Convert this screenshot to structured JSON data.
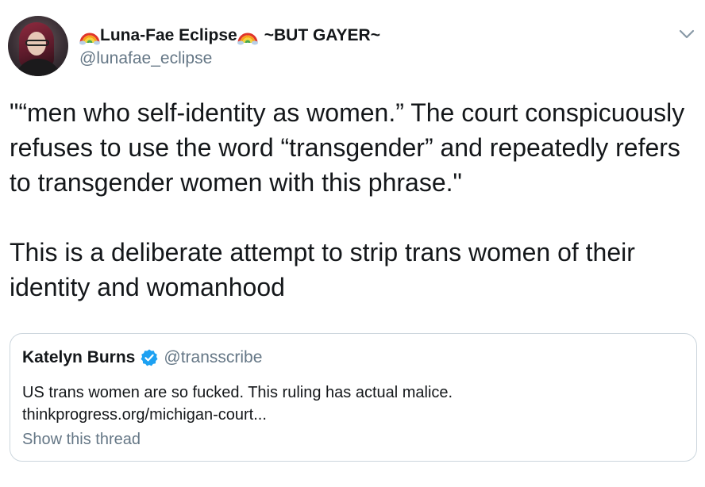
{
  "author": {
    "display_name_text": "Luna-Fae Eclipse",
    "display_name_suffix": "~BUT GAYER~",
    "handle": "@lunafae_eclipse",
    "name_emoji": "rainbow-icon"
  },
  "tweet": {
    "line1": "\"“men who self-identity as women.” The court conspicuously refuses to use the word “transgender” and repeatedly refers to transgender women with this phrase.\"",
    "line2": "This is a deliberate attempt to strip trans women of their identity and womanhood"
  },
  "quoted_tweet": {
    "name": "Katelyn Burns",
    "verified": true,
    "handle": "@transscribe",
    "text": "US trans women are so fucked. This ruling has actual malice.",
    "link": "thinkprogress.org/michigan-court...",
    "show_thread": "Show this thread"
  },
  "colors": {
    "text": "#14171a",
    "secondary": "#657786",
    "border": "#ccd6dd",
    "verified": "#1da1f2"
  }
}
